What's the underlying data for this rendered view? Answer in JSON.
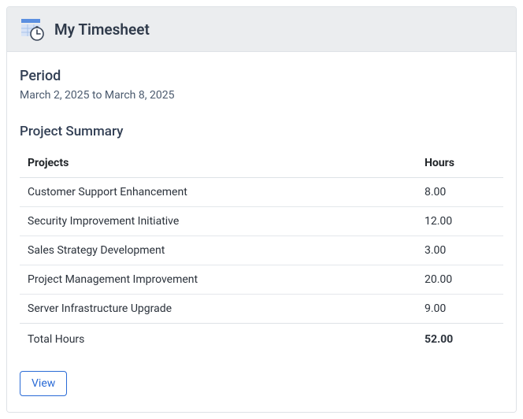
{
  "header": {
    "title": "My Timesheet"
  },
  "period": {
    "label": "Period",
    "value": "March 2, 2025 to March 8, 2025"
  },
  "summary": {
    "title": "Project Summary",
    "columns": {
      "projects": "Projects",
      "hours": "Hours"
    },
    "rows": [
      {
        "project": "Customer Support Enhancement",
        "hours": "8.00"
      },
      {
        "project": "Security Improvement Initiative",
        "hours": "12.00"
      },
      {
        "project": "Sales Strategy Development",
        "hours": "3.00"
      },
      {
        "project": "Project Management Improvement",
        "hours": "20.00"
      },
      {
        "project": "Server Infrastructure Upgrade",
        "hours": "9.00"
      }
    ],
    "total": {
      "label": "Total Hours",
      "value": "52.00"
    }
  },
  "actions": {
    "view": "View"
  }
}
